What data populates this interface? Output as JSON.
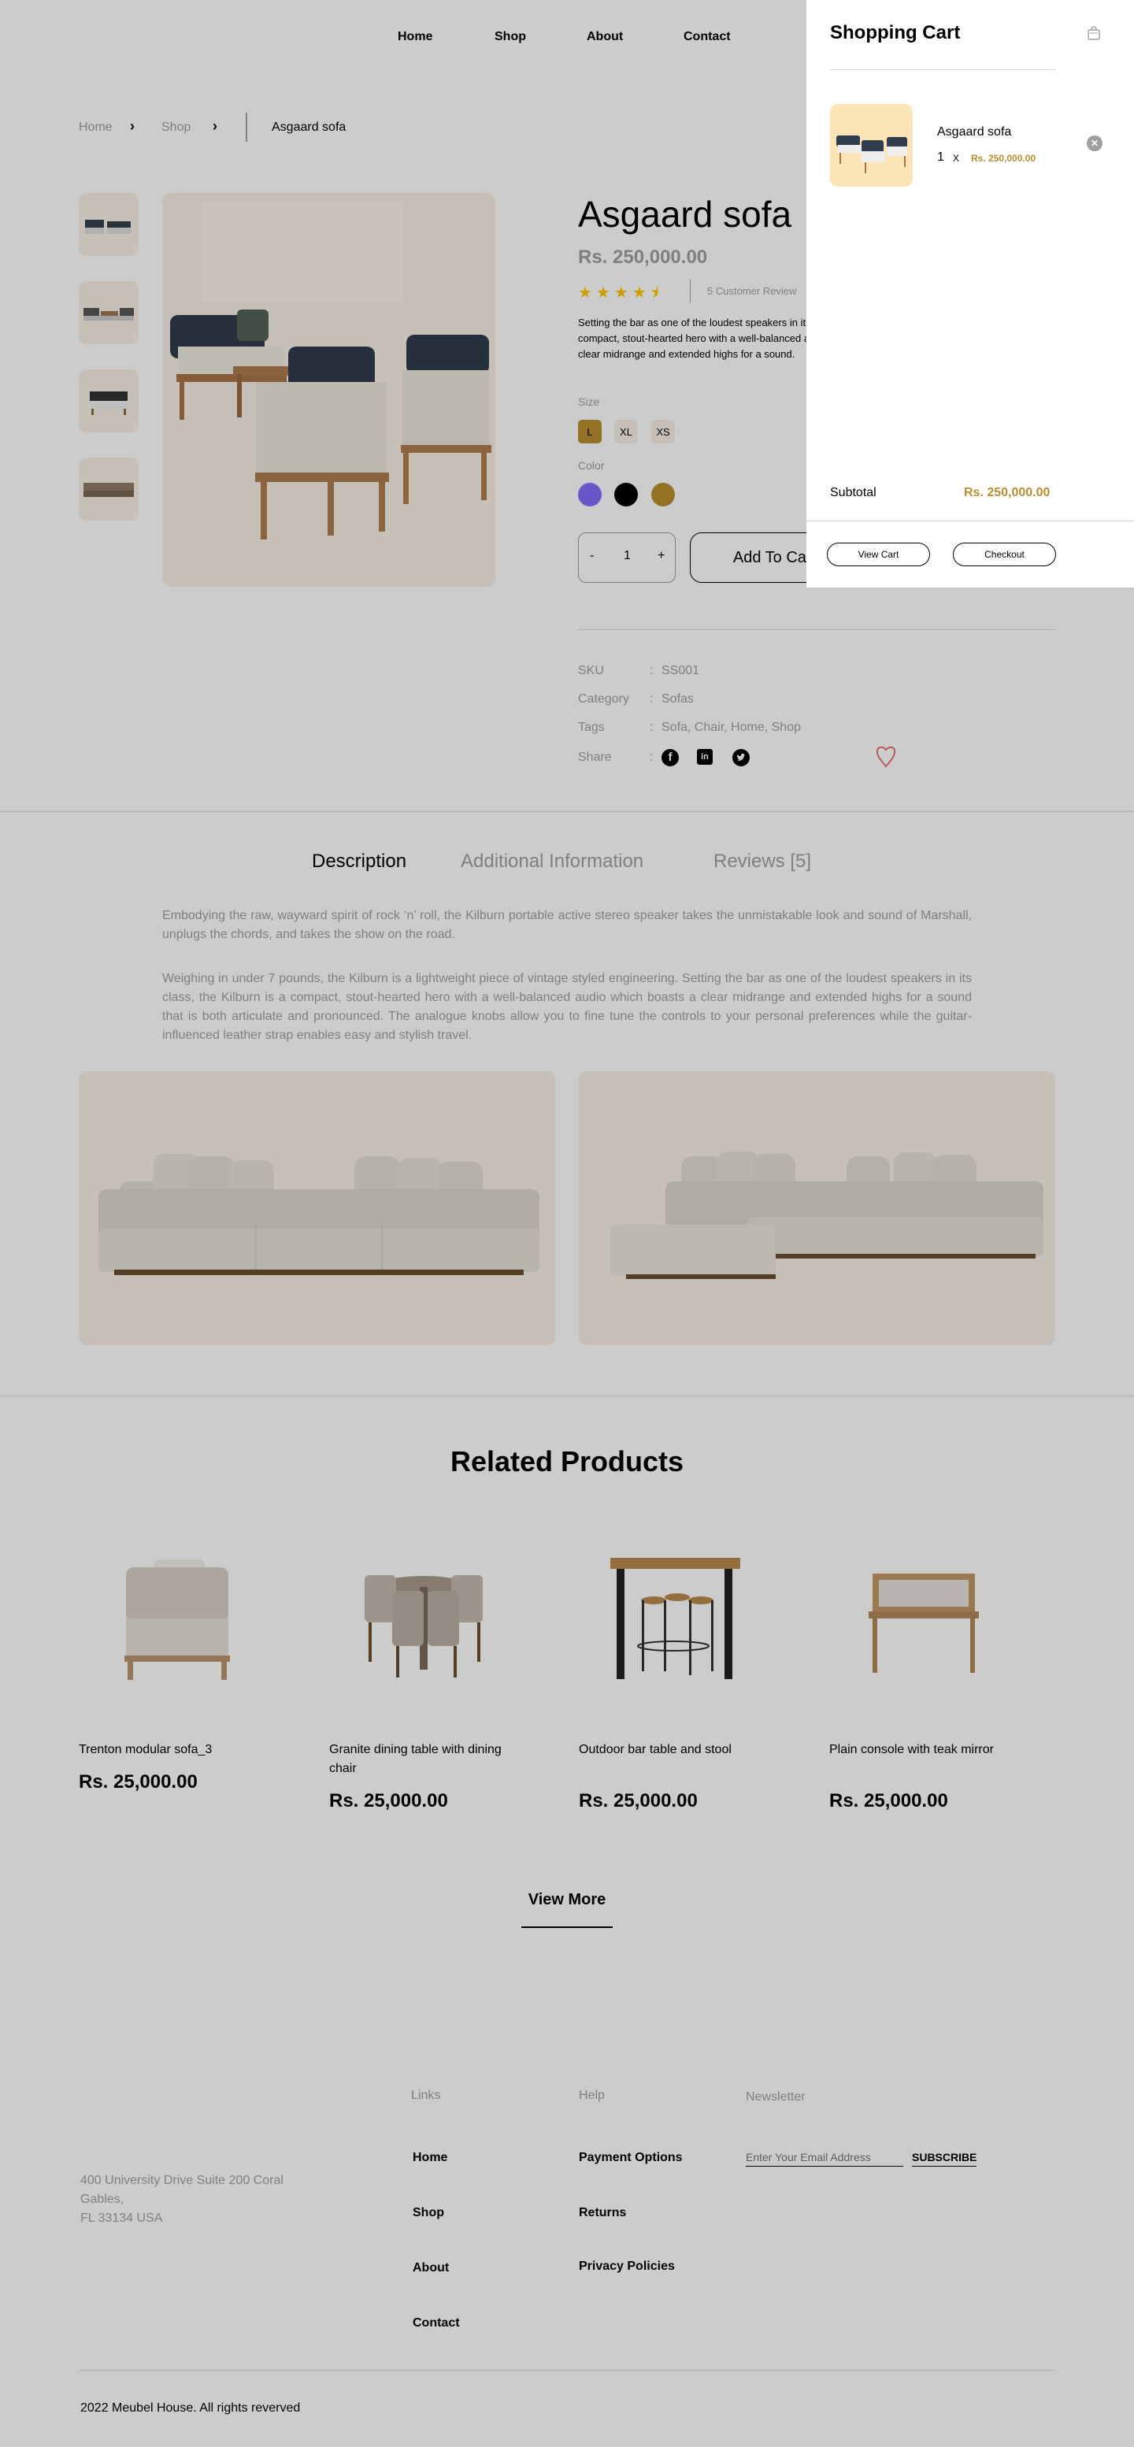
{
  "nav": {
    "home": "Home",
    "shop": "Shop",
    "about": "About",
    "contact": "Contact"
  },
  "breadcrumb": {
    "home": "Home",
    "shop": "Shop",
    "sep": "›",
    "current": "Asgaard sofa"
  },
  "product": {
    "title": "Asgaard sofa",
    "price": "Rs. 250,000.00",
    "rating": 4.5,
    "reviews_label": "5 Customer Review",
    "short_desc": "Setting the bar as one of the loudest speakers in its class, the Kilburn is a compact, stout-hearted hero with a well-balanced audio which boasts a clear midrange and extended highs for a sound.",
    "size_label": "Size",
    "sizes": [
      "L",
      "XL",
      "XS"
    ],
    "color_label": "Color",
    "colors": [
      "#816dfa",
      "#000000",
      "#b88e2f"
    ],
    "qty_minus": "-",
    "qty_value": "1",
    "qty_plus": "+",
    "add_to_cart": "Add To Cart",
    "sku_label": "SKU",
    "sku": "SS001",
    "category_label": "Category",
    "category": "Sofas",
    "tags_label": "Tags",
    "tags": "Sofa, Chair, Home, Shop",
    "share_label": "Share",
    "colon": ":"
  },
  "tabs": {
    "description": "Description",
    "additional": "Additional Information",
    "reviews": "Reviews [5]"
  },
  "description": {
    "p1": "Embodying the raw, wayward spirit of rock ‘n’ roll, the Kilburn portable active stereo speaker takes the unmistakable look and sound of Marshall, unplugs the chords, and takes the show on the road.",
    "p2": "Weighing in under 7 pounds, the Kilburn is a lightweight piece of vintage styled engineering. Setting the bar as one of the loudest speakers in its class, the Kilburn is a compact, stout-hearted hero with a well-balanced audio which boasts a clear midrange and extended highs for a sound that is both articulate and pronounced. The analogue knobs allow you to fine tune the controls to your personal preferences while the guitar-influenced leather strap enables easy and stylish travel."
  },
  "related": {
    "title": "Related Products",
    "items": [
      {
        "name": "Trenton modular sofa_3",
        "price": "Rs. 25,000.00"
      },
      {
        "name": "Granite dining table with dining chair",
        "price": "Rs. 25,000.00"
      },
      {
        "name": "Outdoor bar table and stool",
        "price": "Rs. 25,000.00"
      },
      {
        "name": "Plain console with teak mirror",
        "price": "Rs. 25,000.00"
      }
    ],
    "view_more": "View More"
  },
  "footer": {
    "address_1": "400 University Drive Suite 200 Coral",
    "address_2": "Gables,",
    "address_3": "FL 33134 USA",
    "links_title": "Links",
    "links": [
      "Home",
      "Shop",
      "About",
      "Contact"
    ],
    "help_title": "Help",
    "help": [
      "Payment Options",
      "Returns",
      "Privacy Policies"
    ],
    "newsletter_title": "Newsletter",
    "email_placeholder": "Enter Your Email Address",
    "subscribe": "SUBSCRIBE",
    "copyright": "2022 Meubel House. All rights reverved"
  },
  "cart": {
    "title": "Shopping Cart",
    "item_name": "Asgaard sofa",
    "item_qty": "1",
    "item_x": "X",
    "item_price": "Rs. 250,000.00",
    "subtotal_label": "Subtotal",
    "subtotal_value": "Rs. 250,000.00",
    "view_cart": "View Cart",
    "checkout": "Checkout"
  },
  "icons": {
    "chevron": "chevron-right-icon",
    "star": "star-icon",
    "heart": "heart-icon",
    "close": "close-icon",
    "bag": "bag-icon",
    "facebook": "facebook-icon",
    "linkedin": "linkedin-icon",
    "twitter": "twitter-icon"
  },
  "accent": "#b88e2f"
}
